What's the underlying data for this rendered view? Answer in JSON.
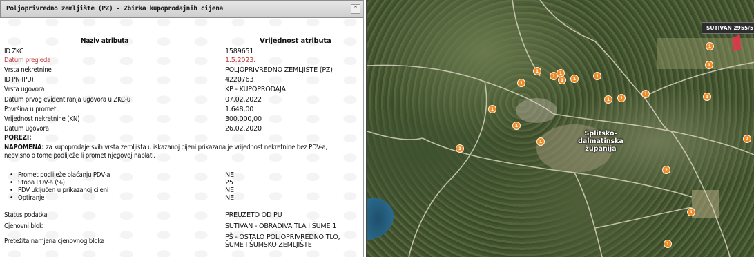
{
  "panel": {
    "title": "Poljoprivredno zemljište (PZ) - Zbirka kupoprodajnih cijena",
    "collapse_icon": "chevron-up-double",
    "col_headers": {
      "name": "Naziv atributa",
      "value": "Vrijednost atributa"
    },
    "rows": [
      {
        "label": "ID ZKC",
        "value": "1589651"
      },
      {
        "label": "Datum pregleda",
        "value": "1.5.2023."
      },
      {
        "label": "Vrsta nekretnine",
        "value": "POLJOPRIVREDNO ZEMLJIŠTE (PZ)"
      },
      {
        "label": "ID PN (PU)",
        "value": "4220763"
      },
      {
        "label": "Vrsta ugovora",
        "value": "KP - KUPOPRODAJA"
      },
      {
        "label": "Datum prvog evidentiranja ugovora u ZKC-u",
        "value": "07.02.2022"
      },
      {
        "label": "Površina u prometu",
        "value": "1.648,00"
      },
      {
        "label": "Vrijednost nekretnine (KN)",
        "value": "300.000,00"
      },
      {
        "label": "Datum ugovora",
        "value": "26.02.2020"
      }
    ],
    "porezi_heading": "POREZI:",
    "napomena_label": "NAPOMENA:",
    "napomena_text": " za kupoprodaje svih vrsta zemljišta u iskazanoj cijeni prikazana je vrijednost nekretnine bez PDV-a, neovisno o tome podliježe li promet njegovoj naplati.",
    "tax_items": [
      {
        "label": "Promet podliježe plaćanju PDV-a",
        "value": "NE"
      },
      {
        "label": "Stopa PDV-a (%)",
        "value": "25"
      },
      {
        "label": "PDV uključen u prikazanoj cijeni",
        "value": "NE"
      },
      {
        "label": "Optiranje",
        "value": "NE"
      }
    ],
    "bottom_rows": [
      {
        "label": "Status podatka",
        "value": "PREUZETO OD PU"
      },
      {
        "label": "Cjenovni blok",
        "value": "SUTIVAN - OBRADIVA TLA I ŠUME 1"
      },
      {
        "label": "Pretežita namjena cjenovnog bloka",
        "value": "PŠ - OSTALO POLJOPRIVREDNO TLO, ŠUME I ŠUMSKO ZEMLJIŠTE"
      }
    ]
  },
  "map": {
    "tooltip": "SUTIVAN 2955/5",
    "region_label": "Splitsko-dalmatinska županija",
    "marker_color": "#f08a24",
    "selected_parcel_color": "#e8334a",
    "markers": [
      "1",
      "1",
      "1",
      "1",
      "1",
      "1",
      "1",
      "1",
      "1",
      "1",
      "1",
      "1",
      "1",
      "1",
      "1",
      "1",
      "2",
      "2",
      "1",
      "1",
      "1"
    ]
  }
}
